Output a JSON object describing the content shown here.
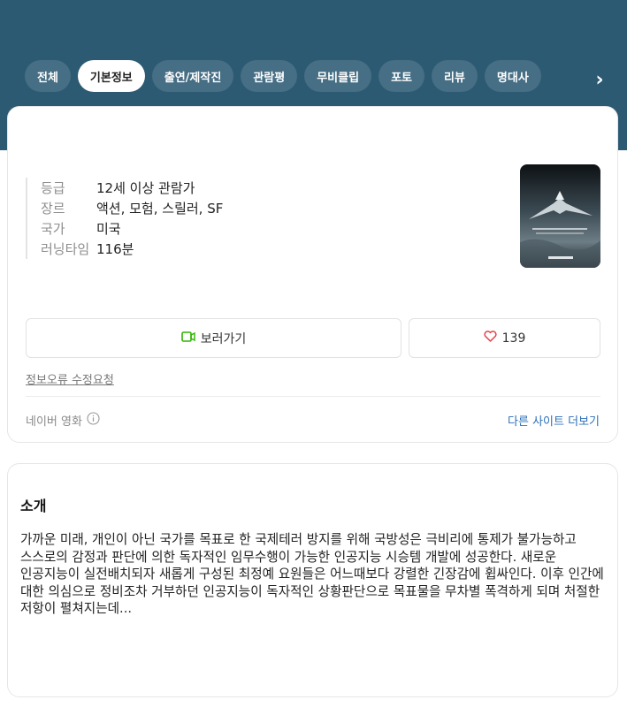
{
  "tabs": [
    {
      "label": "전체"
    },
    {
      "label": "기본정보"
    },
    {
      "label": "출연/제작진"
    },
    {
      "label": "관람평"
    },
    {
      "label": "무비클립"
    },
    {
      "label": "포토"
    },
    {
      "label": "리뷰"
    },
    {
      "label": "명대사"
    }
  ],
  "tab_next": "›",
  "info": [
    {
      "label": "등급",
      "value": "12세 이상 관람가"
    },
    {
      "label": "장르",
      "value": "액션, 모험, 스릴러, SF"
    },
    {
      "label": "국가",
      "value": "미국"
    },
    {
      "label": "러닝타임",
      "value": "116분"
    }
  ],
  "actions": {
    "watch_label": "보러가기",
    "like_count": "139"
  },
  "report_link": "정보오류 수정요청",
  "source": {
    "label": "네이버 영화",
    "more": "다른 사이트 더보기"
  },
  "intro": {
    "title": "소개",
    "text": "가까운 미래, 개인이 아닌 국가를 목표로 한 국제테러 방지를 위해 국방성은 극비리에 통제가 불가능하고 스스로의 감정과 판단에 의한 독자적인 임무수행이 가능한 인공지능 시승템 개발에 성공한다. 새로운 인공지능이 실전배치되자 새롭게 구성된 최정예 요원들은 어느때보다 강렬한 긴장감에 휩싸인다. 이후 인간에 대한 의심으로 정비조차 거부하던 인공지능이 독자적인 상황판단으로 목표물을 무차별 폭격하게 되며 처절한 저항이 펼쳐지는데..."
  },
  "colors": {
    "header": "#2d5a73",
    "accent_green": "#2db400",
    "heart": "#e8414c",
    "link": "#2e6fb8"
  }
}
